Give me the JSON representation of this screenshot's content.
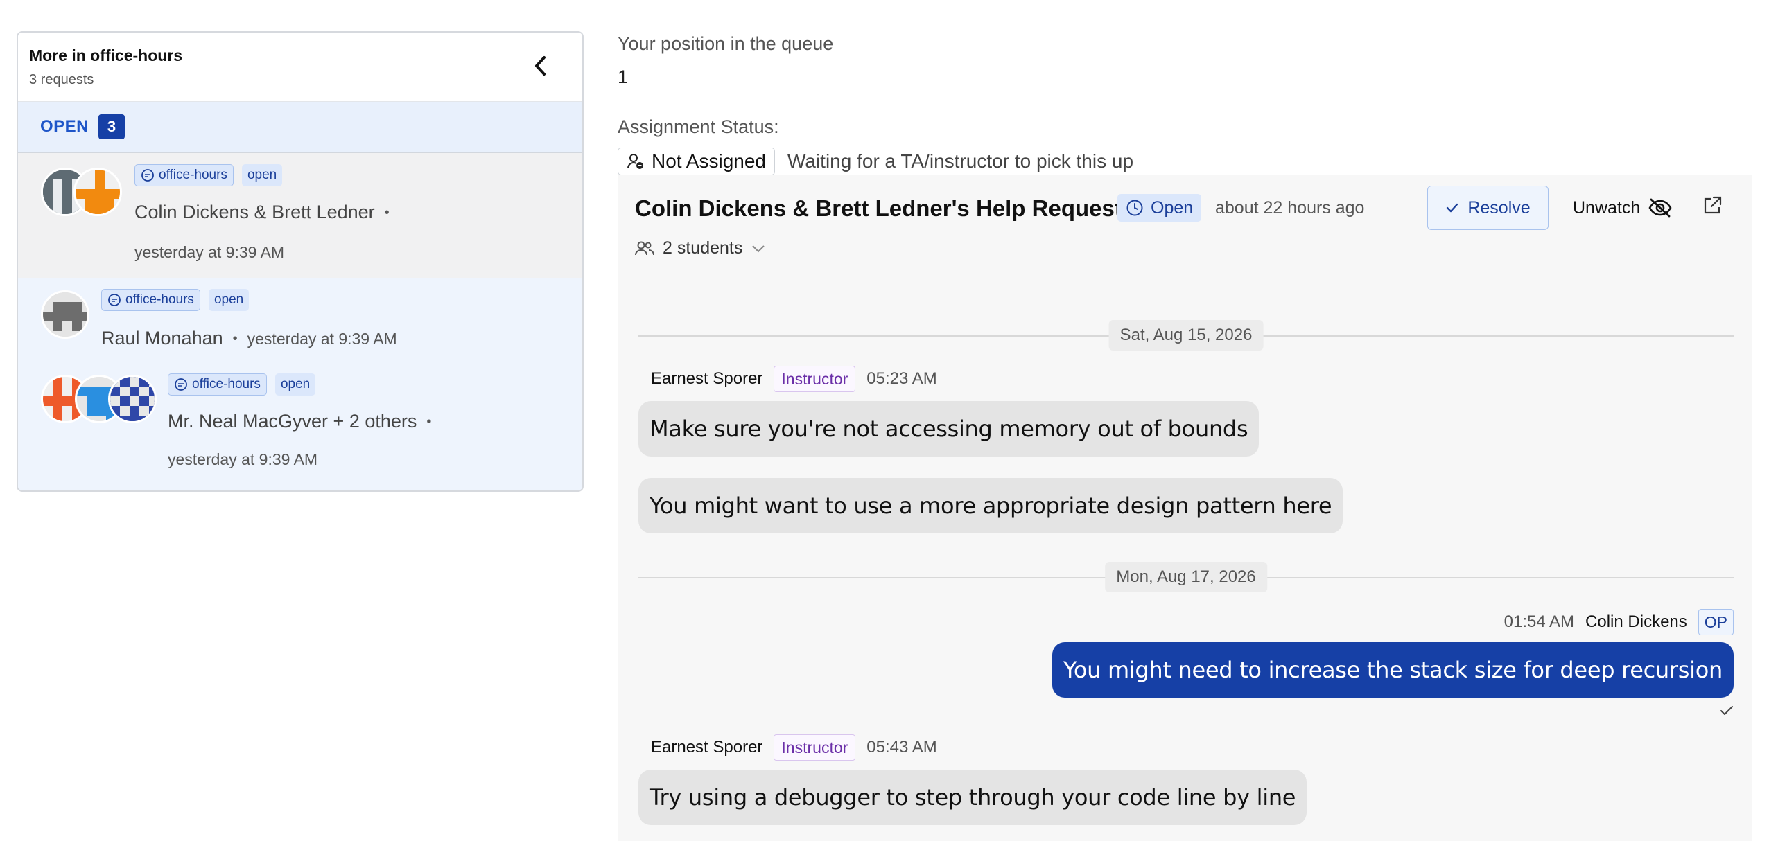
{
  "sidebar": {
    "title": "More in office-hours",
    "subtitle": "3 requests",
    "open_label": "OPEN",
    "open_count": "3",
    "requests": [
      {
        "tag": "office-hours",
        "status": "open",
        "name": "Colin Dickens & Brett Ledner",
        "time": "yesterday at 9:39 AM"
      },
      {
        "tag": "office-hours",
        "status": "open",
        "name": "Raul Monahan",
        "time": "yesterday at 9:39 AM"
      },
      {
        "tag": "office-hours",
        "status": "open",
        "name": "Mr. Neal MacGyver + 2 others",
        "time": "yesterday at 9:39 AM"
      }
    ]
  },
  "queue": {
    "label": "Your position in the queue",
    "value": "1",
    "assignment_label": "Assignment Status:",
    "assignment_status": "Not Assigned",
    "assignment_note": "Waiting for a TA/instructor to pick this up"
  },
  "chat": {
    "title": "Colin Dickens & Brett Ledner's Help Request",
    "status": "Open",
    "age": "about 22 hours ago",
    "resolve_label": "Resolve",
    "unwatch_label": "Unwatch",
    "students_label": "2 students",
    "dates": [
      "Sat, Aug 15, 2026",
      "Mon, Aug 17, 2026"
    ],
    "messages": [
      {
        "author": "Earnest Sporer",
        "role": "Instructor",
        "time": "05:23 AM",
        "texts": [
          "Make sure you're not accessing memory out of bounds",
          "You might want to use a more appropriate design pattern here"
        ]
      },
      {
        "author": "Colin Dickens",
        "role": "OP",
        "time": "01:54 AM",
        "texts": [
          "You might need to increase the stack size for deep recursion"
        ]
      },
      {
        "author": "Earnest Sporer",
        "role": "Instructor",
        "time": "05:43 AM",
        "texts": [
          "Try using a debugger to step through your code line by line"
        ]
      }
    ]
  },
  "colors": {
    "accent": "#1640a6",
    "accent_light": "#dbe7fb",
    "instructor": "#6b2fa8"
  }
}
